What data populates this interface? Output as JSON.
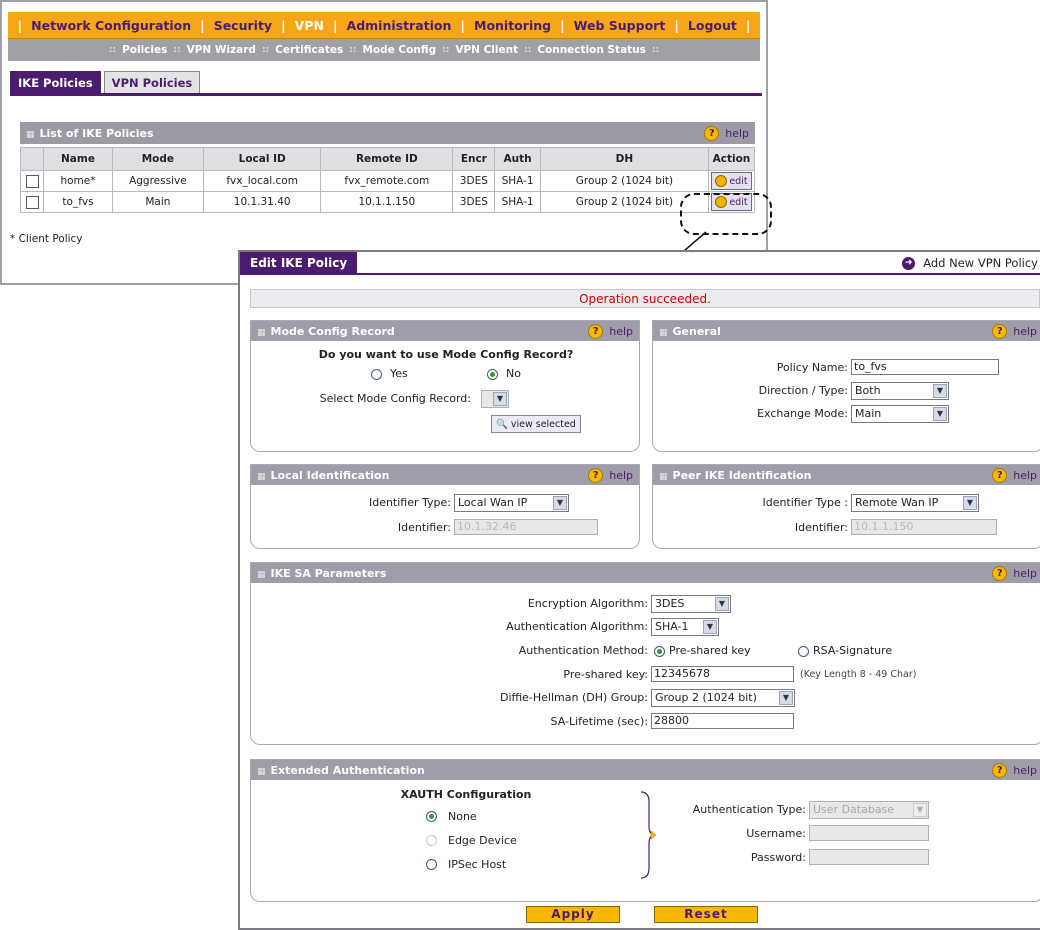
{
  "nav": {
    "items": [
      "Network Configuration",
      "Security",
      "VPN",
      "Administration",
      "Monitoring",
      "Web Support",
      "Logout"
    ],
    "active": "VPN"
  },
  "subnav": {
    "items": [
      "Policies",
      "VPN Wizard",
      "Certificates",
      "Mode Config",
      "VPN Client",
      "Connection Status"
    ]
  },
  "tabs": {
    "ike": "IKE Policies",
    "vpn": "VPN Policies"
  },
  "list": {
    "title": "List of IKE Policies",
    "help": "help",
    "columns": [
      "Name",
      "Mode",
      "Local ID",
      "Remote ID",
      "Encr",
      "Auth",
      "DH",
      "Action"
    ],
    "rows": [
      {
        "name": "home*",
        "mode": "Aggressive",
        "local_id": "fvx_local.com",
        "remote_id": "fvx_remote.com",
        "encr": "3DES",
        "auth": "SHA-1",
        "dh": "Group 2 (1024 bit)",
        "action": "edit"
      },
      {
        "name": "to_fvs",
        "mode": "Main",
        "local_id": "10.1.31.40",
        "remote_id": "10.1.1.150",
        "encr": "3DES",
        "auth": "SHA-1",
        "dh": "Group 2 (1024 bit)",
        "action": "edit"
      }
    ],
    "note": "* Client Policy"
  },
  "edit": {
    "title": "Edit IKE Policy",
    "add_vpn": "Add New VPN Policy",
    "status": "Operation succeeded.",
    "help": "help",
    "mode_config": {
      "title": "Mode Config Record",
      "question": "Do you want to use Mode Config Record?",
      "yes": "Yes",
      "no": "No",
      "select_label": "Select Mode Config Record:",
      "view_btn": "view selected"
    },
    "general": {
      "title": "General",
      "policy_name_label": "Policy Name:",
      "policy_name": "to_fvs",
      "direction_label": "Direction / Type:",
      "direction": "Both",
      "exchange_label": "Exchange Mode:",
      "exchange": "Main"
    },
    "local_id": {
      "title": "Local Identification",
      "type_label": "Identifier Type:",
      "type": "Local Wan IP",
      "id_label": "Identifier:",
      "id": "10.1.32.46"
    },
    "peer_id": {
      "title": "Peer IKE Identification",
      "type_label": "Identifier Type :",
      "type": "Remote Wan IP",
      "id_label": "Identifier:",
      "id": "10.1.1.150"
    },
    "sa": {
      "title": "IKE SA Parameters",
      "enc_label": "Encryption Algorithm:",
      "enc": "3DES",
      "auth_label": "Authentication Algorithm:",
      "auth": "SHA-1",
      "method_label": "Authentication Method:",
      "method_psk": "Pre-shared key",
      "method_rsa": "RSA-Signature",
      "psk_label": "Pre-shared key:",
      "psk": "12345678",
      "psk_hint": "(Key Length 8 - 49 Char)",
      "dh_label": "Diffie-Hellman (DH) Group:",
      "dh": "Group 2 (1024 bit)",
      "life_label": "SA-Lifetime (sec):",
      "life": "28800"
    },
    "xauth": {
      "title": "Extended Authentication",
      "config_label": "XAUTH Configuration",
      "none": "None",
      "edge": "Edge Device",
      "ipsec": "IPSec Host",
      "authtype_label": "Authentication Type:",
      "authtype": "User Database",
      "user_label": "Username:",
      "pass_label": "Password:"
    },
    "apply": "Apply",
    "reset": "Reset"
  }
}
